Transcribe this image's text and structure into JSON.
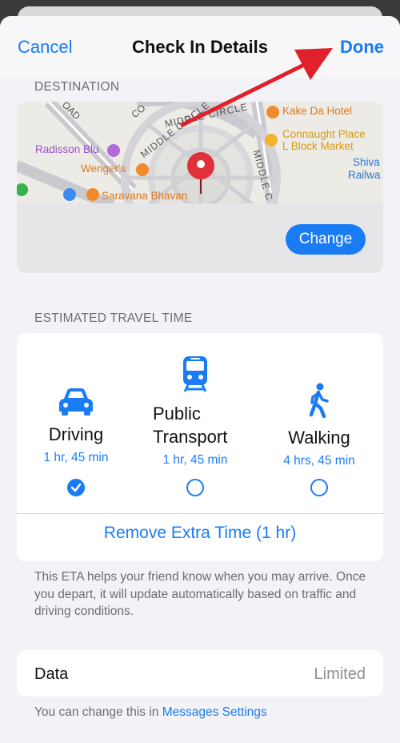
{
  "nav": {
    "cancel_label": "Cancel",
    "title": "Check In Details",
    "done_label": "Done"
  },
  "destination": {
    "header": "DESTINATION",
    "change_label": "Change",
    "map_labels": {
      "road": "OAD",
      "co": "CO",
      "middle_circle_1": "MIDDLE CIRCLE",
      "middle_circle_2": "MIDDLE CIRCLE",
      "middle_c": "MIDDLE C",
      "radisson": "Radisson Blu",
      "wengers": "Wenger's",
      "saravana": "Saravana Bhavan",
      "kake": "Kake Da Hotel",
      "connaught_1": "Connaught Place",
      "connaught_2": "L Block Market",
      "shiva_1": "Shiva",
      "shiva_2": "Railwa"
    }
  },
  "travel": {
    "header": "ESTIMATED TRAVEL TIME",
    "modes": [
      {
        "name": "Driving",
        "time": "1 hr, 45 min",
        "icon": "car-icon",
        "selected": true
      },
      {
        "name_line1": "Public",
        "name_line2": "Transport",
        "time": "1 hr, 45 min",
        "icon": "train-icon",
        "selected": false
      },
      {
        "name": "Walking",
        "time": "4 hrs, 45 min",
        "icon": "walking-icon",
        "selected": false
      }
    ],
    "remove_extra_label": "Remove Extra Time (1 hr)",
    "footnote": "This ETA helps your friend know when you may arrive. Once you depart, it will update automatically based on traffic and driving conditions."
  },
  "data_setting": {
    "label": "Data",
    "value": "Limited",
    "footnote_prefix": "You can change this in ",
    "footnote_link": "Messages Settings"
  },
  "colors": {
    "accent": "#1a7cf5",
    "annotation_arrow": "#e0202a",
    "map_pin": "#e0303a"
  }
}
